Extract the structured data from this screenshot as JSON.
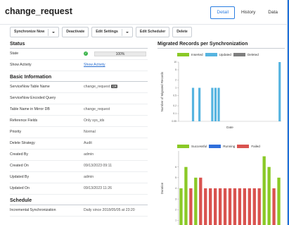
{
  "page": {
    "title": "change_request"
  },
  "tabs": [
    {
      "label": "Detail",
      "active": true
    },
    {
      "label": "History",
      "active": false
    },
    {
      "label": "Data",
      "active": false
    }
  ],
  "toolbar": {
    "sync_now": "Synchronize Now",
    "deactivate": "Deactivate",
    "edit_settings": "Edit Settings",
    "edit_scheduler": "Edit Scheduler",
    "delete": "Delete"
  },
  "status": {
    "section_title": "Status",
    "state_label": "State",
    "progress_text": "100%",
    "progress": 1.0,
    "show_activity_label": "Show Activity",
    "show_activity_link": "Show Activity"
  },
  "basic": {
    "section_title": "Basic Information",
    "table_name_label": "ServiceNow Table Name",
    "table_name_value": "change_request",
    "table_name_tag": "CR",
    "encoded_query_label": "ServiceNow Encoded Query",
    "encoded_query_value": "",
    "mirror_table_label": "Table Name in Mirror DB",
    "mirror_table_value": "change_request",
    "reference_label": "Reference Fields",
    "reference_value": "Only sys_ids",
    "priority_label": "Priority",
    "priority_value": "Normal",
    "delete_strategy_label": "Delete Strategy",
    "delete_strategy_value": "Audit",
    "created_by_label": "Created By",
    "created_by_value": "admin",
    "created_on_label": "Created On",
    "created_on_value": "09/13/2023 09:11",
    "updated_by_label": "Updated By",
    "updated_by_value": "admin",
    "updated_on_label": "Updated On",
    "updated_on_value": "09/13/2023 11:26"
  },
  "schedule": {
    "section_title": "Schedule",
    "incremental_label": "Incremental Synchronization",
    "incremental_value": "Daily since 2018/05/05 at 23:20"
  },
  "charts_panel": {
    "title": "Migrated Records per Synchronization"
  },
  "colors": {
    "green": "#8ac926",
    "blue": "#56b4e0",
    "gray": "#7f7f7f",
    "dblue": "#2f6fdb",
    "red": "#d9534f",
    "accent": "#2a7de1"
  },
  "chart_data": [
    {
      "type": "bar",
      "legend": [
        "Inserted",
        "Updated",
        "Deleted"
      ],
      "ylabel": "Number of Migrated Records",
      "xlabel": "Date",
      "yticks": [
        "10",
        "5",
        "2",
        "1",
        "0.5",
        "0.2",
        "0.1",
        "0.05"
      ],
      "series": [
        {
          "name": "Updated",
          "values": [
            0,
            0,
            0,
            0,
            1,
            0,
            1,
            0,
            0,
            0,
            1,
            1,
            1,
            0,
            0,
            0,
            0,
            0,
            0,
            0,
            0,
            0,
            0,
            0,
            0,
            0,
            0,
            0,
            0,
            0,
            0,
            10
          ]
        }
      ]
    },
    {
      "type": "bar",
      "legend": [
        "Successful",
        "Running",
        "Failed"
      ],
      "ylabel": "Duration",
      "xlabel": "Date",
      "yticks": [
        "6",
        "5",
        "4",
        "3",
        "2",
        "1"
      ],
      "series": [
        {
          "name": "Successful",
          "values": [
            4,
            6,
            0,
            5,
            0,
            0,
            0,
            0,
            0,
            0,
            0,
            0,
            0,
            0,
            0,
            0,
            0,
            7,
            6,
            0,
            5
          ]
        },
        {
          "name": "Failed",
          "values": [
            0,
            0,
            4,
            0,
            5,
            4,
            4,
            4,
            4,
            4,
            4,
            4,
            4,
            4,
            4,
            4,
            4,
            0,
            0,
            4,
            0
          ]
        }
      ]
    }
  ]
}
